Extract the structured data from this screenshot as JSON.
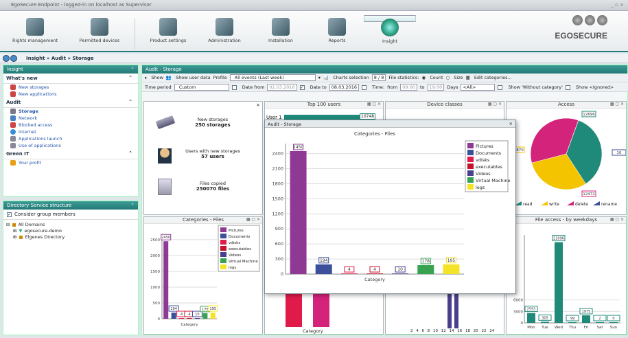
{
  "window": {
    "title": "EgoSecure Endpoint - logged-in on localhost as Supervisor",
    "controls": "_ ▫ ×"
  },
  "ribbon": {
    "tabs": [
      "Rights management",
      "Permitted devices",
      "Product settings",
      "Administration",
      "Installation",
      "Reports",
      "Insight"
    ],
    "logo": "EGOSECURE"
  },
  "breadcrumb": "Insight » Audit » Storage",
  "sidebar": {
    "title": "Insight",
    "whats_new": "What's new",
    "items_new": [
      "New storages",
      "New applications"
    ],
    "audit": "Audit",
    "items_audit": [
      "Storage",
      "Network",
      "Blocked access",
      "Internet",
      "Applications launch",
      "Use of applications"
    ],
    "green": "Green IT",
    "items_green": [
      "Your profit"
    ]
  },
  "directory": {
    "title": "Directory Service structure",
    "consider": "Consider group members",
    "tree": [
      "All Domains",
      "egosecure-demo",
      "Elgenes Directory"
    ]
  },
  "main": {
    "title": "Audit - Storage"
  },
  "toolbar1": {
    "show": "Show",
    "show_user": "Show user data",
    "profile_label": "Profile",
    "profile_value": "All events (Last week)",
    "charts_sel": "Charts selection",
    "charts_count": "8 / 8",
    "file_stat": "File statistics:",
    "count": "Count",
    "size": "Size",
    "edit_cat": "Edit categories..."
  },
  "toolbar2": {
    "period_label": "Time period",
    "period_value": "Custom",
    "date_from_label": "Date from",
    "date_from": "02.03.2016",
    "date_to_label": "Date to",
    "date_to": "08.03.2016",
    "time_label": "Time:",
    "from_label": "from",
    "from_val": "09:00",
    "to_label": "to",
    "to_val": "19:00",
    "days_label": "Days",
    "days_val": "<All>",
    "show_without": "Show 'Without category'",
    "show_ignored": "Show <Ignored>"
  },
  "stats": [
    {
      "label": "New storages",
      "value": "250 storages"
    },
    {
      "label": "Users with new storages",
      "value": "57 users"
    },
    {
      "label": "Files copied",
      "value": "250070 files"
    }
  ],
  "cards": {
    "top_users": "Top 100 users",
    "top_user_name": "User 1",
    "top_user_value": "10748",
    "device_classes": "Device classes",
    "access": "Access",
    "categories": "Categories - Files",
    "weekdays": "File access - by weekdays",
    "category_axis": "Category"
  },
  "access_legend": [
    "read",
    "write",
    "delete",
    "rename"
  ],
  "dialog": {
    "title": "Audit - Storage",
    "chart_title": "Categories - Files",
    "xlabel": "Category"
  },
  "chart_data": [
    {
      "type": "bar",
      "title": "Categories - Files",
      "xlabel": "Category",
      "categories": [
        "Pictures",
        "Documents",
        "vdisks",
        "executables",
        "Videos",
        "Virtual Machine",
        "logs"
      ],
      "values": [
        2450,
        194,
        4,
        4,
        10,
        178,
        195
      ],
      "colors": [
        "#8e3a94",
        "#3b4f9a",
        "#e01b4a",
        "#c4122b",
        "#4a3f8f",
        "#37a351",
        "#f5e327"
      ],
      "ylim": [
        0,
        2600
      ],
      "yticks": [
        0,
        300,
        600,
        900,
        1200,
        1500,
        1800,
        2100,
        2400
      ],
      "legend": [
        "Pictures",
        "Documents",
        "vdisks",
        "executables",
        "Videos",
        "Virtual Machine",
        "logs"
      ]
    },
    {
      "type": "bar",
      "title": "Categories - Files",
      "xlabel": "Category",
      "categories": [
        "Pictures",
        "Documents",
        "vdisks",
        "executables",
        "Videos",
        "Virtual Machine",
        "logs"
      ],
      "values": [
        2450,
        194,
        4,
        4,
        10,
        178,
        195
      ],
      "yticks": [
        0,
        500,
        1000,
        1500,
        2000,
        2500
      ],
      "ylim": [
        0,
        2650
      ]
    },
    {
      "type": "pie",
      "title": "Access",
      "labels": [
        "read",
        "write",
        "delete",
        "rename"
      ],
      "values": [
        12696,
        10870,
        12472,
        10
      ],
      "colors": [
        "#1f8a7a",
        "#f5c400",
        "#d4237a",
        "#3b4f9a"
      ]
    },
    {
      "type": "bar",
      "title": "File access - by weekdays",
      "categories": [
        "Mon",
        "Tue",
        "Wed",
        "Thu",
        "Fri",
        "Sat",
        "Sun"
      ],
      "values": [
        2593,
        305,
        21096,
        99,
        1975,
        2,
        0
      ],
      "yticks": [
        0,
        3000,
        6000
      ],
      "ylim": [
        0,
        23000
      ]
    }
  ]
}
